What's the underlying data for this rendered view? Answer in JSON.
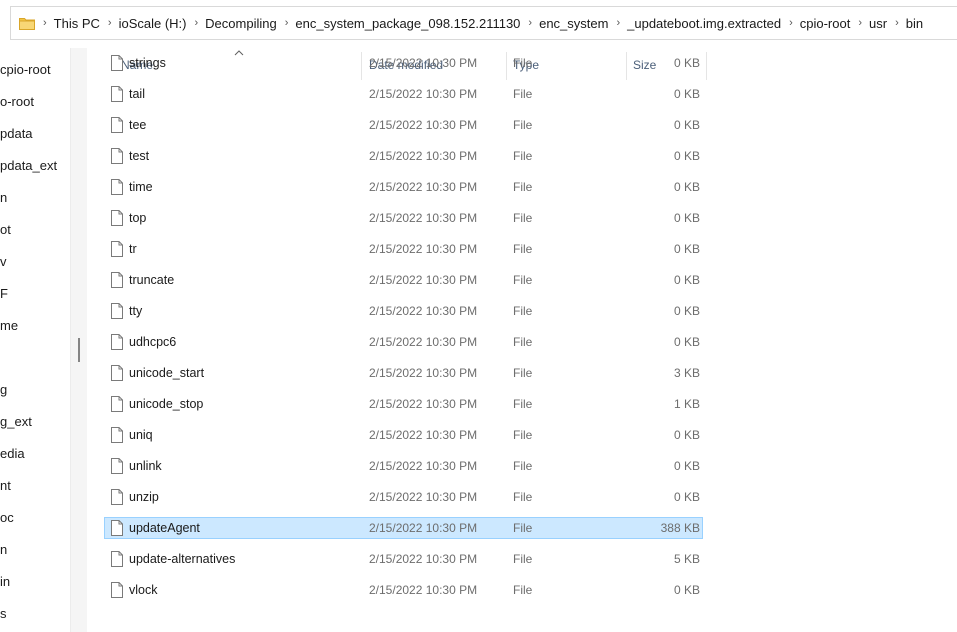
{
  "address_bar": {
    "breadcrumbs": [
      "This PC",
      "ioScale (H:)",
      "Decompiling",
      "enc_system_package_098.152.211130",
      "enc_system",
      "_updateboot.img.extracted",
      "cpio-root",
      "usr",
      "bin"
    ]
  },
  "nav_pane": {
    "items": [
      "cpio-root",
      "o-root",
      "pdata",
      "pdata_ext",
      "n",
      "ot",
      "v",
      "F",
      "me",
      "",
      "g",
      "g_ext",
      "edia",
      "nt",
      "oc",
      "n",
      "in",
      "s"
    ]
  },
  "columns": {
    "name": "Name",
    "date": "Date modified",
    "type": "Type",
    "size": "Size"
  },
  "files": [
    {
      "name": "strings",
      "date": "2/15/2022 10:30 PM",
      "type": "File",
      "size": "0 KB"
    },
    {
      "name": "tail",
      "date": "2/15/2022 10:30 PM",
      "type": "File",
      "size": "0 KB"
    },
    {
      "name": "tee",
      "date": "2/15/2022 10:30 PM",
      "type": "File",
      "size": "0 KB"
    },
    {
      "name": "test",
      "date": "2/15/2022 10:30 PM",
      "type": "File",
      "size": "0 KB"
    },
    {
      "name": "time",
      "date": "2/15/2022 10:30 PM",
      "type": "File",
      "size": "0 KB"
    },
    {
      "name": "top",
      "date": "2/15/2022 10:30 PM",
      "type": "File",
      "size": "0 KB"
    },
    {
      "name": "tr",
      "date": "2/15/2022 10:30 PM",
      "type": "File",
      "size": "0 KB"
    },
    {
      "name": "truncate",
      "date": "2/15/2022 10:30 PM",
      "type": "File",
      "size": "0 KB"
    },
    {
      "name": "tty",
      "date": "2/15/2022 10:30 PM",
      "type": "File",
      "size": "0 KB"
    },
    {
      "name": "udhcpc6",
      "date": "2/15/2022 10:30 PM",
      "type": "File",
      "size": "0 KB"
    },
    {
      "name": "unicode_start",
      "date": "2/15/2022 10:30 PM",
      "type": "File",
      "size": "3 KB"
    },
    {
      "name": "unicode_stop",
      "date": "2/15/2022 10:30 PM",
      "type": "File",
      "size": "1 KB"
    },
    {
      "name": "uniq",
      "date": "2/15/2022 10:30 PM",
      "type": "File",
      "size": "0 KB"
    },
    {
      "name": "unlink",
      "date": "2/15/2022 10:30 PM",
      "type": "File",
      "size": "0 KB"
    },
    {
      "name": "unzip",
      "date": "2/15/2022 10:30 PM",
      "type": "File",
      "size": "0 KB"
    },
    {
      "name": "updateAgent",
      "date": "2/15/2022 10:30 PM",
      "type": "File",
      "size": "388 KB",
      "selected": true
    },
    {
      "name": "update-alternatives",
      "date": "2/15/2022 10:30 PM",
      "type": "File",
      "size": "5 KB"
    },
    {
      "name": "vlock",
      "date": "2/15/2022 10:30 PM",
      "type": "File",
      "size": "0 KB"
    }
  ],
  "colors": {
    "selection_bg": "#cce8ff",
    "selection_border": "#99d1ff",
    "header_text": "#4c607a",
    "folder_yellow": "#f3c545"
  },
  "icons": {
    "address_folder": "folder-icon",
    "separator": "chevron-right-icon",
    "file": "file-icon",
    "sort": "chevron-up-icon"
  }
}
